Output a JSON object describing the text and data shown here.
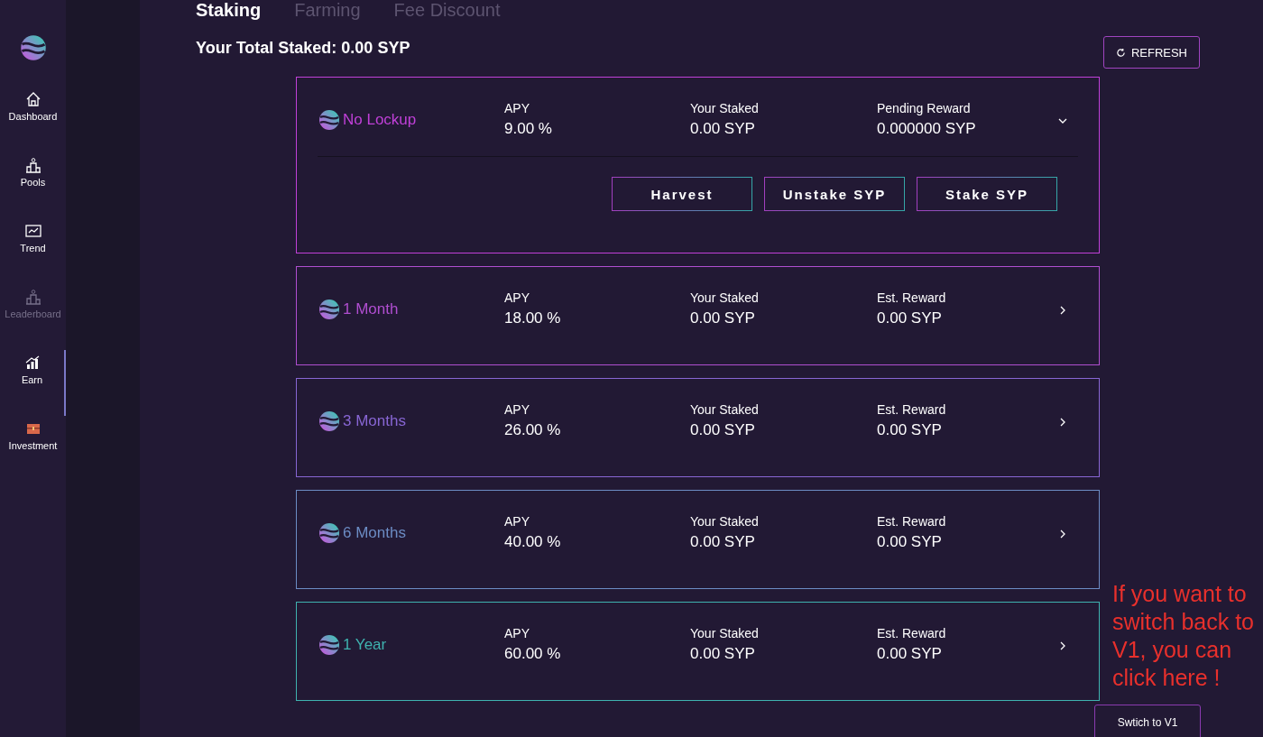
{
  "sidebar": {
    "items": [
      {
        "label": "Dashboard",
        "selected": false,
        "disabled": false
      },
      {
        "label": "Pools",
        "selected": false,
        "disabled": false
      },
      {
        "label": "Trend",
        "selected": false,
        "disabled": false
      },
      {
        "label": "Leaderboard",
        "selected": false,
        "disabled": true
      },
      {
        "label": "Earn",
        "selected": true,
        "disabled": false
      },
      {
        "label": "Investment",
        "selected": false,
        "disabled": false
      }
    ]
  },
  "tabs": [
    {
      "label": "Staking",
      "selected": true
    },
    {
      "label": "Farming",
      "selected": false
    },
    {
      "label": "Fee Discount",
      "selected": false
    }
  ],
  "total_staked": "Your Total Staked: 0.00 SYP",
  "refresh_button": "REFRESH",
  "pools": [
    {
      "name": "No Lockup",
      "color": "#c040d8",
      "expanded": true,
      "columns": [
        {
          "label": "APY",
          "value": "9.00 %"
        },
        {
          "label": "Your Staked",
          "value": "0.00 SYP"
        },
        {
          "label": "Pending Reward",
          "value": "0.000000 SYP"
        }
      ],
      "actions": [
        "Harvest",
        "Unstake SYP",
        "Stake SYP"
      ]
    },
    {
      "name": "1 Month",
      "color": "#b04ed0",
      "expanded": false,
      "columns": [
        {
          "label": "APY",
          "value": "18.00 %"
        },
        {
          "label": "Your Staked",
          "value": "0.00 SYP"
        },
        {
          "label": "Est. Reward",
          "value": "0.00 SYP"
        }
      ]
    },
    {
      "name": "3 Months",
      "color": "#8866d4",
      "expanded": false,
      "columns": [
        {
          "label": "APY",
          "value": "26.00 %"
        },
        {
          "label": "Your Staked",
          "value": "0.00 SYP"
        },
        {
          "label": "Est. Reward",
          "value": "0.00 SYP"
        }
      ]
    },
    {
      "name": "6 Months",
      "color": "#6c8cc4",
      "expanded": false,
      "columns": [
        {
          "label": "APY",
          "value": "40.00 %"
        },
        {
          "label": "Your Staked",
          "value": "0.00 SYP"
        },
        {
          "label": "Est. Reward",
          "value": "0.00 SYP"
        }
      ]
    },
    {
      "name": "1 Year",
      "color": "#3fb3b0",
      "expanded": false,
      "columns": [
        {
          "label": "APY",
          "value": "60.00 %"
        },
        {
          "label": "Your Staked",
          "value": "0.00 SYP"
        },
        {
          "label": "Est. Reward",
          "value": "0.00 SYP"
        }
      ]
    }
  ],
  "annotation": "If you want to switch back to V1, you can click here !",
  "switch_button": "Swtich to V1"
}
